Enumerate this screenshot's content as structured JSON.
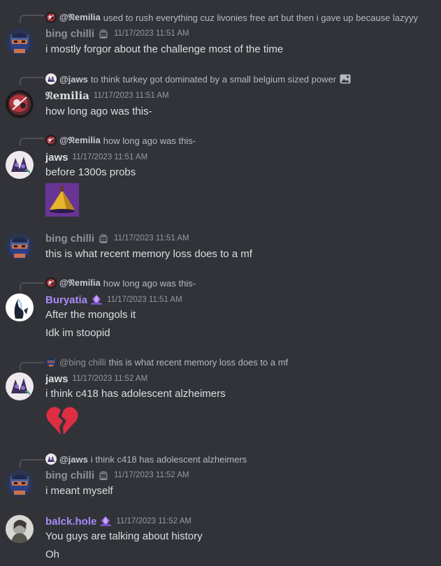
{
  "colors": {
    "background": "#313338",
    "text": "#dbdee1",
    "muted": "#949ba4",
    "name_default": "#dbdee1",
    "name_gray": "#8e9297",
    "name_purple": "#a78bfa"
  },
  "messages": [
    {
      "reply": {
        "author": "@𝔑emilia",
        "text": "used to rush everything cuz livonies free art but then i gave up because lazyyy"
      },
      "author": "bing chilli",
      "timestamp": "11/17/2023 11:51 AM",
      "lines": [
        "i mostly forgor about the challenge most of the time"
      ]
    },
    {
      "reply": {
        "author": "@jaws",
        "text": "to think turkey got dominated by a small belgium sized power"
      },
      "author": "𝔑emilia",
      "timestamp": "11/17/2023 11:51 AM",
      "lines": [
        "how long ago was this-"
      ]
    },
    {
      "reply": {
        "author": "@𝔑emilia",
        "text": "how long ago was this-"
      },
      "author": "jaws",
      "timestamp": "11/17/2023 11:51 AM",
      "lines": [
        "before 1300s probs"
      ]
    },
    {
      "author": "bing chilli",
      "timestamp": "11/17/2023 11:51 AM",
      "lines": [
        "this is what recent memory loss does to a mf"
      ]
    },
    {
      "reply": {
        "author": "@𝔑emilia",
        "text": "how long ago was this-"
      },
      "author": "Buryatia",
      "timestamp": "11/17/2023 11:51 AM",
      "lines": [
        "After the mongols it",
        "Idk im stoopid"
      ]
    },
    {
      "reply": {
        "author": "@bing chilli",
        "text": "this is what recent memory loss does to a mf"
      },
      "author": "jaws",
      "timestamp": "11/17/2023 11:52 AM",
      "lines": [
        "i think c418 has adolescent alzheimers"
      ]
    },
    {
      "reply": {
        "author": "@jaws",
        "text": "i think c418 has adolescent alzheimers"
      },
      "author": "bing chilli",
      "timestamp": "11/17/2023 11:52 AM",
      "lines": [
        "i meant myself"
      ]
    },
    {
      "author": "balck.hole",
      "timestamp": "11/17/2023 11:52 AM",
      "lines": [
        "You guys are talking about history",
        "Oh"
      ]
    }
  ],
  "icons": {
    "attachment": "image-icon",
    "emoji": "broken-heart-emoji"
  }
}
